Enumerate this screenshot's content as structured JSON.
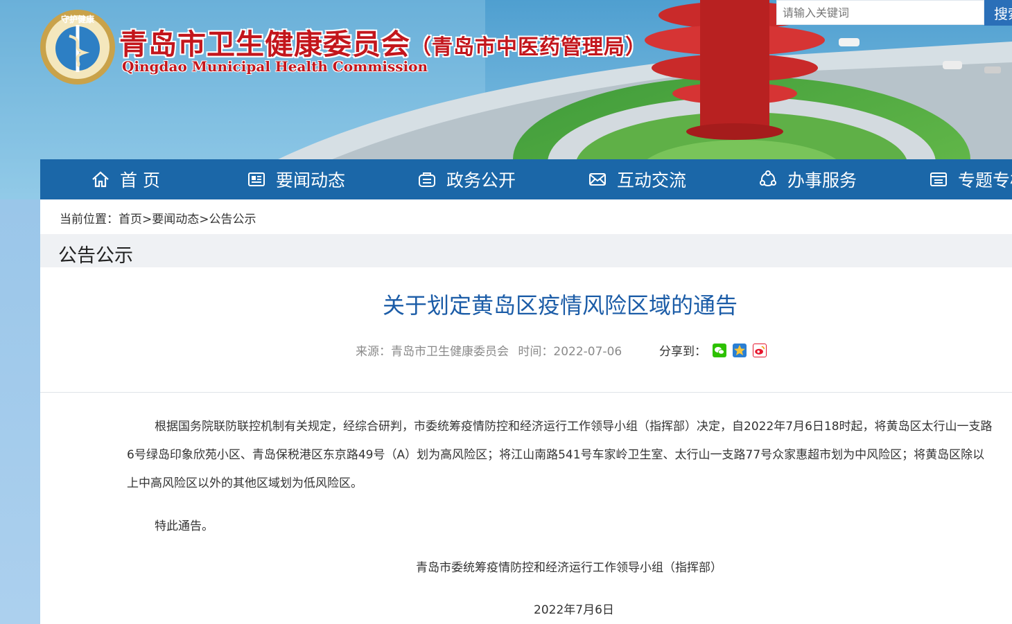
{
  "header": {
    "title_cn": "青岛市卫生健康委员会",
    "title_cn_sub": "（青岛市中医药管理局）",
    "title_en": "Qingdao Municipal Health Commission",
    "logo_text": "守护健康"
  },
  "search": {
    "placeholder": "请输入关键词",
    "button_label": "搜索"
  },
  "nav": {
    "items": [
      {
        "label": "首 页",
        "icon": "home-icon"
      },
      {
        "label": "要闻动态",
        "icon": "news-icon"
      },
      {
        "label": "政务公开",
        "icon": "government-icon"
      },
      {
        "label": "互动交流",
        "icon": "mail-icon"
      },
      {
        "label": "办事服务",
        "icon": "service-icon"
      },
      {
        "label": "专题专栏",
        "icon": "topic-icon"
      }
    ]
  },
  "breadcrumb": {
    "prefix": "当前位置：",
    "items": [
      "首页",
      "要闻动态",
      "公告公示"
    ],
    "separator": ">"
  },
  "section": {
    "title": "公告公示"
  },
  "article": {
    "title": "关于划定黄岛区疫情风险区域的通告",
    "source": "来源：青岛市卫生健康委员会",
    "time": "时间：2022-07-06",
    "share_label": "分享到：",
    "paragraphs": [
      "根据国务院联防联控机制有关规定，经综合研判，市委统筹疫情防控和经济运行工作领导小组（指挥部）决定，自2022年7月6日18时起，将黄岛区太行山一支路6号绿岛印象欣苑小区、青岛保税港区东京路49号（A）划为高风险区；将江山南路541号车家岭卫生室、太行山一支路77号众家惠超市划为中风险区；将黄岛区除以上中高风险区以外的其他区域划为低风险区。",
      "特此通告。"
    ],
    "signature": "青岛市委统筹疫情防控和经济运行工作领导小组（指挥部）",
    "date": "2022年7月6日"
  },
  "colors": {
    "nav_bg": "#1b67a8",
    "title_red": "#c3161c",
    "article_title_blue": "#1b5ca7",
    "section_bar_bg": "#eff1f4",
    "wechat_green": "#2dc100",
    "qzone_blue": "#2a7fd4",
    "weibo_red": "#e6162d"
  }
}
